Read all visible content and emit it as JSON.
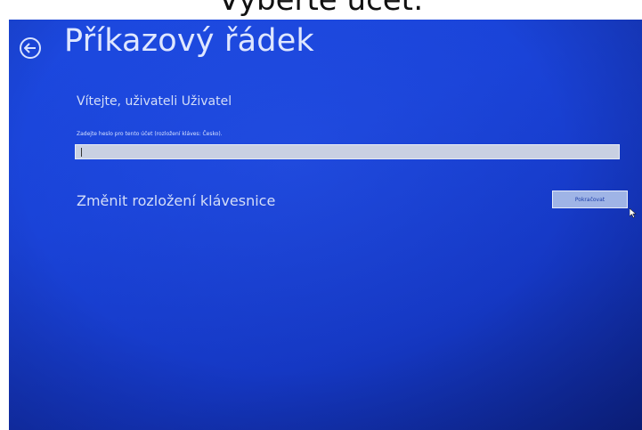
{
  "caption": "Vyberte účet:",
  "header": {
    "title": "Příkazový řádek"
  },
  "login": {
    "welcome": "Vítejte, uživateli Uživatel",
    "prompt": "Zadejte heslo pro tento účet (rozložení kláves: Česko).",
    "password_value": "",
    "change_layout_label": "Změnit rozložení klávesnice",
    "continue_label": "Pokračovat"
  },
  "icons": {
    "back": "back-arrow-icon",
    "cursor": "mouse-pointer-icon"
  },
  "colors": {
    "background": "#1a43d8",
    "text": "#dfe7ff",
    "field": "#c9d0e2"
  }
}
